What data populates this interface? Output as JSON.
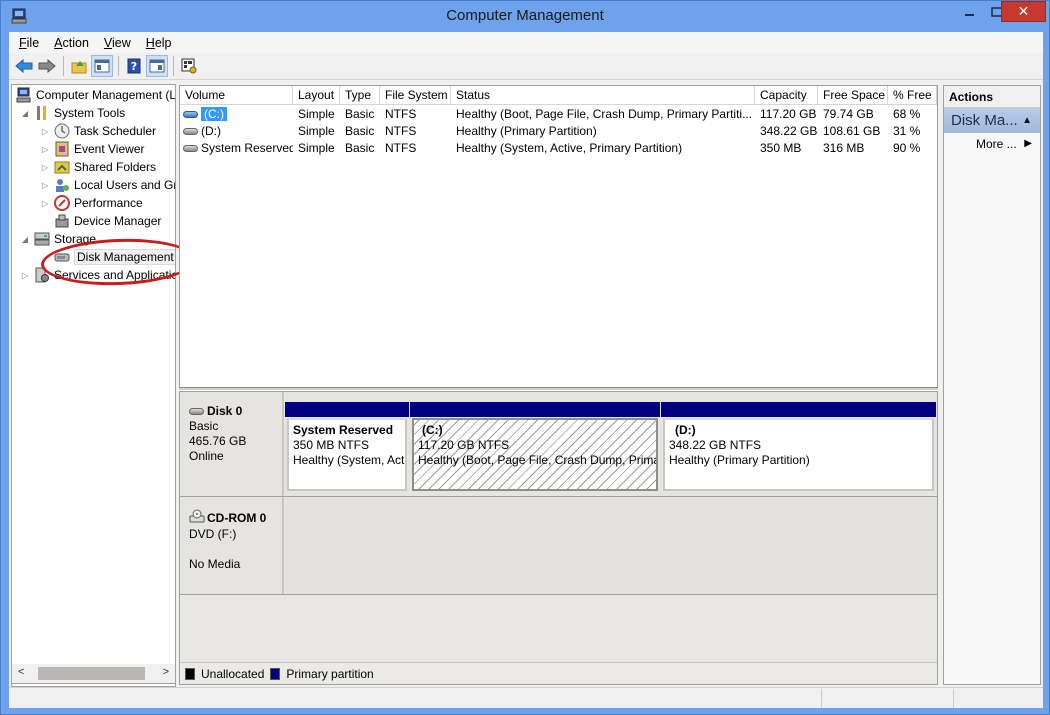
{
  "window": {
    "title": "Computer Management"
  },
  "menu": {
    "items": [
      {
        "label": "File",
        "key": "F"
      },
      {
        "label": "Action",
        "key": "A"
      },
      {
        "label": "View",
        "key": "V"
      },
      {
        "label": "Help",
        "key": "H"
      }
    ]
  },
  "toolbar": {
    "buttons": [
      "back-icon",
      "forward-icon",
      "up-folder-icon",
      "show-hide-console-tree-icon",
      "help-icon",
      "show-hide-action-pane-icon",
      "properties-icon"
    ]
  },
  "tree": {
    "items": [
      {
        "label": "Computer Management (Local)",
        "level": 0,
        "expander": "none"
      },
      {
        "label": "System Tools",
        "level": 1,
        "expander": "expanded"
      },
      {
        "label": "Task Scheduler",
        "level": 2,
        "expander": "collapsed"
      },
      {
        "label": "Event Viewer",
        "level": 2,
        "expander": "collapsed"
      },
      {
        "label": "Shared Folders",
        "level": 2,
        "expander": "collapsed"
      },
      {
        "label": "Local Users and Groups",
        "level": 2,
        "expander": "collapsed"
      },
      {
        "label": "Performance",
        "level": 2,
        "expander": "collapsed"
      },
      {
        "label": "Device Manager",
        "level": 2,
        "expander": "none"
      },
      {
        "label": "Storage",
        "level": 1,
        "expander": "expanded"
      },
      {
        "label": "Disk Management",
        "level": 2,
        "expander": "none",
        "selected": true
      },
      {
        "label": "Services and Applications",
        "level": 1,
        "expander": "collapsed"
      }
    ]
  },
  "volume_list": {
    "columns": [
      "Volume",
      "Layout",
      "Type",
      "File System",
      "Status",
      "Capacity",
      "Free Space",
      "% Free"
    ],
    "rows": [
      {
        "volume": "(C:)",
        "layout": "Simple",
        "type": "Basic",
        "fs": "NTFS",
        "status": "Healthy (Boot, Page File, Crash Dump, Primary Partiti...",
        "capacity": "117.20 GB",
        "free": "79.74 GB",
        "pct": "68 %",
        "selected": true
      },
      {
        "volume": "(D:)",
        "layout": "Simple",
        "type": "Basic",
        "fs": "NTFS",
        "status": "Healthy (Primary Partition)",
        "capacity": "348.22 GB",
        "free": "108.61 GB",
        "pct": "31 %"
      },
      {
        "volume": "System Reserved",
        "layout": "Simple",
        "type": "Basic",
        "fs": "NTFS",
        "status": "Healthy (System, Active, Primary Partition)",
        "capacity": "350 MB",
        "free": "316 MB",
        "pct": "90 %"
      }
    ]
  },
  "disks": [
    {
      "name": "Disk 0",
      "lines": [
        "Basic",
        "465.76 GB",
        "Online"
      ],
      "partitions": [
        {
          "title": "System Reserved",
          "size": "350 MB NTFS",
          "status": "Healthy (System, Act"
        },
        {
          "title": "(C:)",
          "size": "117.20 GB NTFS",
          "status": "Healthy (Boot, Page File, Crash Dump, Prima",
          "hatched": true
        },
        {
          "title": "(D:)",
          "size": "348.22 GB NTFS",
          "status": "Healthy (Primary Partition)"
        }
      ]
    },
    {
      "name": "CD-ROM 0",
      "lines": [
        "DVD (F:)",
        "",
        "No Media"
      ],
      "partitions": []
    }
  ],
  "legend": [
    {
      "label": "Unallocated",
      "color": "#000000"
    },
    {
      "label": "Primary partition",
      "color": "#010080"
    }
  ],
  "actions": {
    "header": "Actions",
    "section": "Disk Ma...",
    "more": "More ..."
  },
  "colors": {
    "primary_partition": "#010080",
    "selection": "#3399ff",
    "title_bar": "#6ea2ea",
    "close_button": "#c7382f",
    "annotation_circle": "#cc1b1b"
  }
}
